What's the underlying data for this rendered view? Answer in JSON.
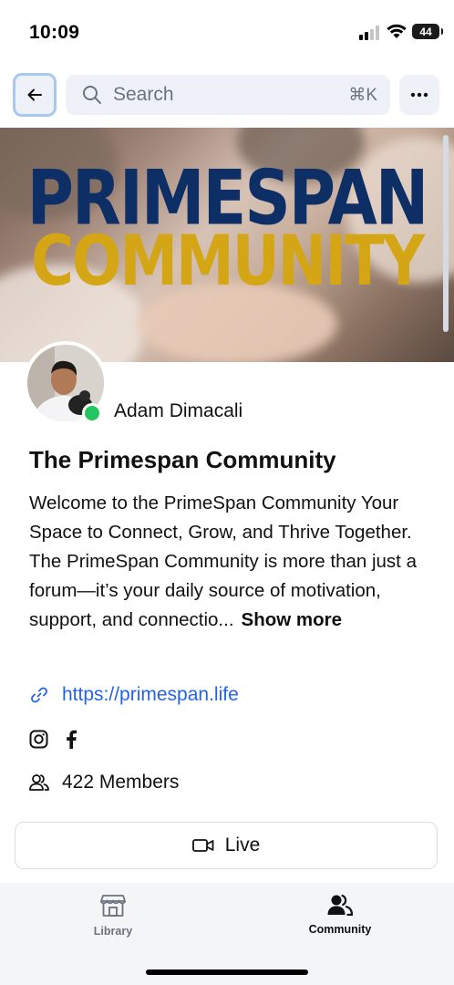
{
  "status_bar": {
    "time": "10:09",
    "battery": "44"
  },
  "toolbar": {
    "back_icon": "arrow-left-icon",
    "search_placeholder": "Search",
    "search_shortcut": "⌘K",
    "more_icon": "more-horizontal-icon"
  },
  "banner": {
    "line1": "PRIMESPAN",
    "line2": "COMMUNITY",
    "colors": {
      "line1": "#0e2f66",
      "line2": "#d4a514"
    }
  },
  "owner": {
    "name": "Adam Dimacali",
    "online": true
  },
  "community": {
    "title": "The Primespan Community",
    "description": "Welcome to the PrimeSpan Community Your Space to Connect, Grow, and Thrive Together.   The PrimeSpan Community is more than just a forum—it’s your daily source of motivation, support, and connectio...",
    "show_more": "Show more",
    "link": "https://primespan.life",
    "social": [
      "instagram-icon",
      "facebook-icon"
    ],
    "members": "422 Members",
    "live_label": "Live"
  },
  "bottom_nav": {
    "items": [
      {
        "label": "Library",
        "icon": "storefront-icon",
        "active": false
      },
      {
        "label": "Community",
        "icon": "users-icon",
        "active": true
      }
    ]
  },
  "colors": {
    "link": "#2563eb",
    "online": "#22c55e",
    "accent_focus": "#a9c8ee"
  }
}
